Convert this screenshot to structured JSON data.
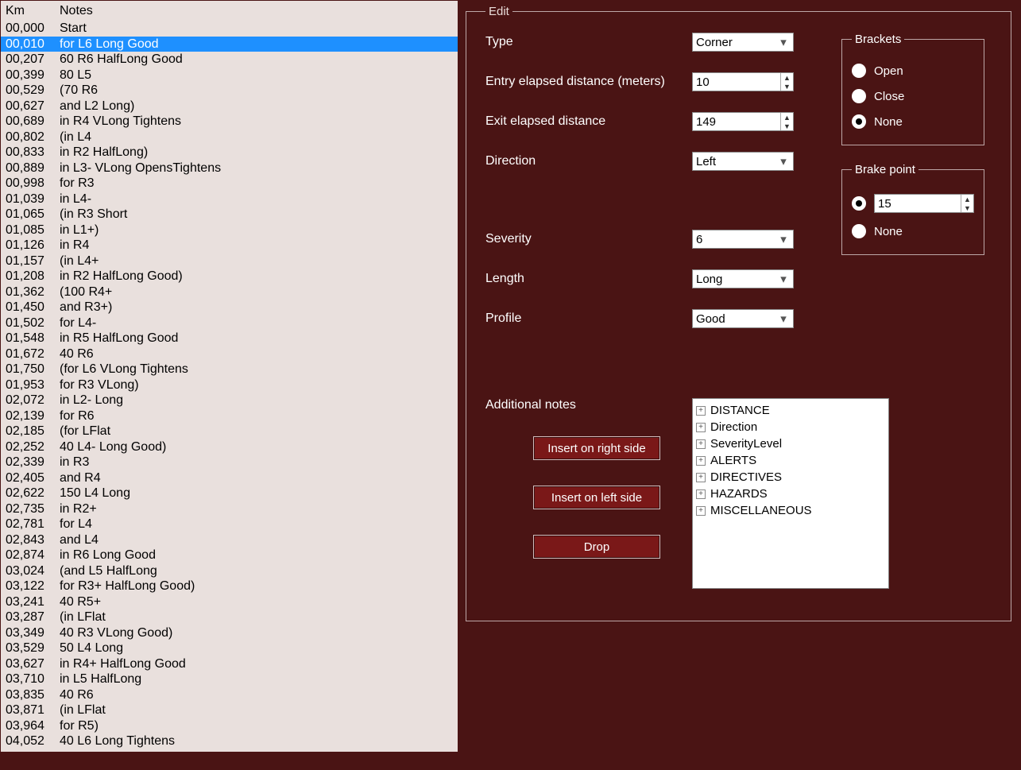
{
  "list": {
    "headers": {
      "km": "Km",
      "notes": "Notes"
    },
    "selected_index": 1,
    "rows": [
      {
        "km": "00,000",
        "notes": "Start"
      },
      {
        "km": "00,010",
        "notes": "for L6 Long Good"
      },
      {
        "km": "00,207",
        "notes": "60 R6 HalfLong Good"
      },
      {
        "km": "00,399",
        "notes": "80 L5"
      },
      {
        "km": "00,529",
        "notes": "(70 R6"
      },
      {
        "km": "00,627",
        "notes": "and L2 Long)"
      },
      {
        "km": "00,689",
        "notes": "in R4 VLong Tightens"
      },
      {
        "km": "00,802",
        "notes": "(in L4"
      },
      {
        "km": "00,833",
        "notes": "in R2 HalfLong)"
      },
      {
        "km": "00,889",
        "notes": "in L3- VLong OpensTightens"
      },
      {
        "km": "00,998",
        "notes": "for R3"
      },
      {
        "km": "01,039",
        "notes": "in L4-"
      },
      {
        "km": "01,065",
        "notes": "(in R3 Short"
      },
      {
        "km": "01,085",
        "notes": "in L1+)"
      },
      {
        "km": "01,126",
        "notes": "in R4"
      },
      {
        "km": "01,157",
        "notes": "(in L4+"
      },
      {
        "km": "01,208",
        "notes": "in R2 HalfLong Good)"
      },
      {
        "km": "01,362",
        "notes": "(100 R4+"
      },
      {
        "km": "01,450",
        "notes": "and R3+)"
      },
      {
        "km": "01,502",
        "notes": "for L4-"
      },
      {
        "km": "01,548",
        "notes": "in R5 HalfLong Good"
      },
      {
        "km": "01,672",
        "notes": "40 R6"
      },
      {
        "km": "01,750",
        "notes": "(for L6 VLong Tightens"
      },
      {
        "km": "01,953",
        "notes": "for R3 VLong)"
      },
      {
        "km": "02,072",
        "notes": "in L2- Long"
      },
      {
        "km": "02,139",
        "notes": "for R6"
      },
      {
        "km": "02,185",
        "notes": "(for LFlat"
      },
      {
        "km": "02,252",
        "notes": "40 L4- Long Good)"
      },
      {
        "km": "02,339",
        "notes": "in R3"
      },
      {
        "km": "02,405",
        "notes": "and R4"
      },
      {
        "km": "02,622",
        "notes": "150 L4 Long"
      },
      {
        "km": "02,735",
        "notes": "in R2+"
      },
      {
        "km": "02,781",
        "notes": "for L4"
      },
      {
        "km": "02,843",
        "notes": "and L4"
      },
      {
        "km": "02,874",
        "notes": "in R6 Long Good"
      },
      {
        "km": "03,024",
        "notes": "(and L5 HalfLong"
      },
      {
        "km": "03,122",
        "notes": "for R3+ HalfLong Good)"
      },
      {
        "km": "03,241",
        "notes": "40 R5+"
      },
      {
        "km": "03,287",
        "notes": "(in LFlat"
      },
      {
        "km": "03,349",
        "notes": "40 R3 VLong Good)"
      },
      {
        "km": "03,529",
        "notes": "50 L4 Long"
      },
      {
        "km": "03,627",
        "notes": "in R4+ HalfLong Good"
      },
      {
        "km": "03,710",
        "notes": "in L5 HalfLong"
      },
      {
        "km": "03,835",
        "notes": "40 R6"
      },
      {
        "km": "03,871",
        "notes": "(in LFlat"
      },
      {
        "km": "03,964",
        "notes": "for R5)"
      },
      {
        "km": "04,052",
        "notes": "40 L6 Long Tightens"
      }
    ]
  },
  "edit": {
    "legend": "Edit",
    "labels": {
      "type": "Type",
      "entry": "Entry elapsed distance (meters)",
      "exit": "Exit elapsed distance",
      "direction": "Direction",
      "severity": "Severity",
      "length": "Length",
      "profile": "Profile",
      "additional": "Additional notes"
    },
    "values": {
      "type": "Corner",
      "entry": "10",
      "exit": "149",
      "direction": "Left",
      "severity": "6",
      "length": "Long",
      "profile": "Good"
    },
    "brackets": {
      "legend": "Brackets",
      "open": "Open",
      "close": "Close",
      "none": "None",
      "selected": "none"
    },
    "brake": {
      "legend": "Brake point",
      "value": "15",
      "none": "None",
      "selected": "value"
    },
    "buttons": {
      "insert_right": "Insert on right side",
      "insert_left": "Insert on left side",
      "drop": "Drop"
    },
    "tree": [
      "DISTANCE",
      "Direction",
      "SeverityLevel",
      "ALERTS",
      "DIRECTIVES",
      "HAZARDS",
      "MISCELLANEOUS"
    ]
  }
}
